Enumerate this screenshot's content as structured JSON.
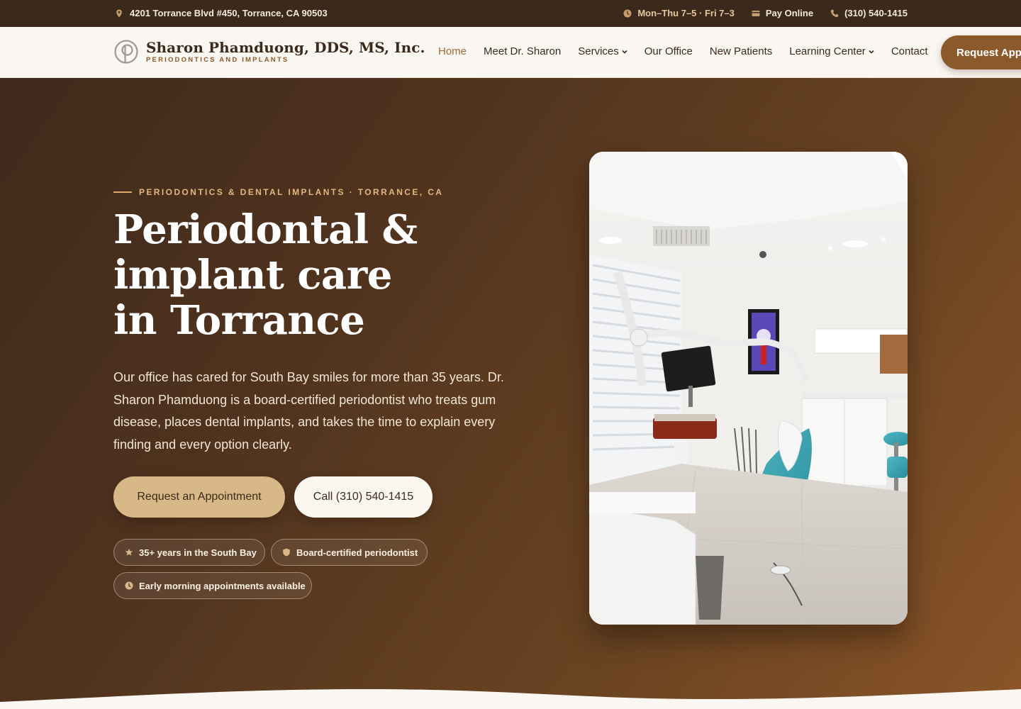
{
  "topbar": {
    "address": "4201 Torrance Blvd #450, Torrance, CA 90503",
    "hours": "Mon–Thu 7–5 · Fri 7–3",
    "pay": "Pay Online",
    "phone": "(310) 540-1415",
    "icons": [
      "location-pin-icon",
      "clock-icon",
      "credit-card-icon",
      "phone-icon"
    ]
  },
  "header": {
    "logo_name": "Sharon Phamduong, DDS, MS, Inc.",
    "logo_sub": "PERIODONTICS AND IMPLANTS",
    "nav": [
      {
        "label": "Home",
        "active": true
      },
      {
        "label": "Meet Dr. Sharon"
      },
      {
        "label": "Services",
        "dropdown": true
      },
      {
        "label": "Our Office"
      },
      {
        "label": "New Patients"
      },
      {
        "label": "Learning Center",
        "dropdown": true
      },
      {
        "label": "Contact"
      }
    ],
    "cta": "Request Appointment"
  },
  "hero": {
    "eyebrow": "PERIODONTICS & DENTAL IMPLANTS · TORRANCE, CA",
    "headline_lines": [
      "Periodontal &",
      "implant care",
      "in Torrance"
    ],
    "lede": "Our office has cared for South Bay smiles for more than 35 years. Dr. Sharon Phamduong is a board-certified periodontist who treats gum disease, places dental implants, and takes the time to explain every finding and every option clearly.",
    "primary_button": "Request an Appointment",
    "secondary_button": "Call (310) 540-1415",
    "badges": [
      {
        "label": "35+ years in the South Bay",
        "icon": "star-icon"
      },
      {
        "label": "Board-certified periodontist",
        "icon": "shield-icon"
      },
      {
        "label": "Early morning appointments available",
        "icon": "clock-icon"
      }
    ]
  },
  "colors": {
    "brand": "#8b5a2b",
    "topbar": "#3b2a1c",
    "accent": "#d9b888",
    "eyebrow": "#e2b77f",
    "page_bg": "#faf6f1"
  }
}
